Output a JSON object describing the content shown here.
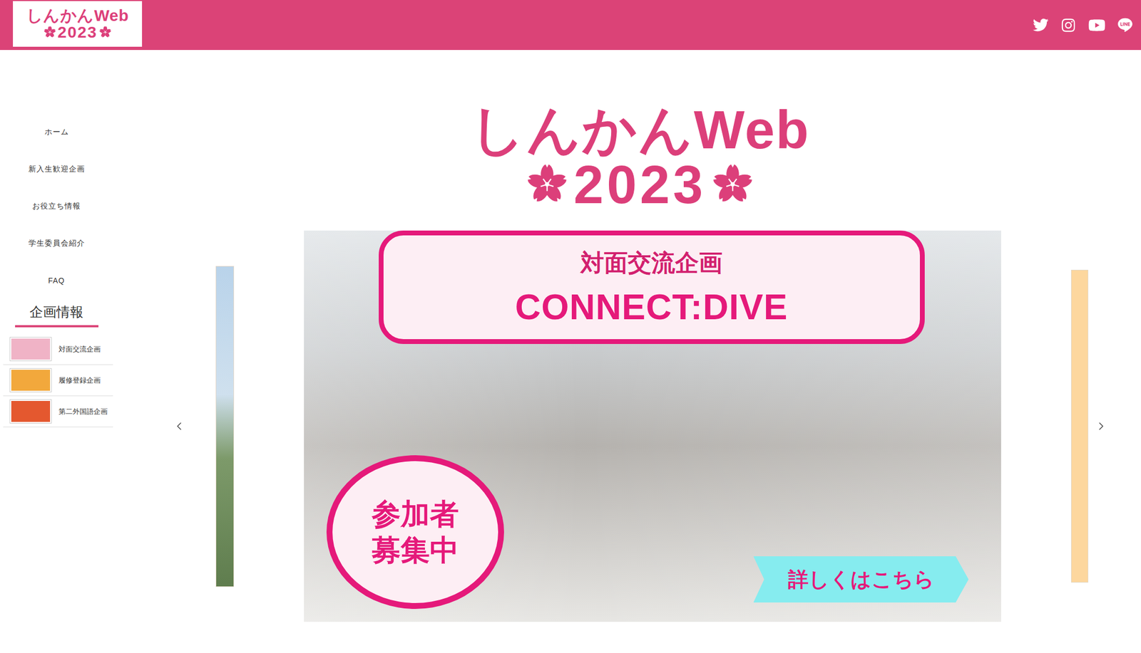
{
  "header": {
    "logo": {
      "title": "しんかんWeb",
      "year": "2023"
    }
  },
  "nav": [
    {
      "label": "ホーム"
    },
    {
      "label": "新入生歓迎企画"
    },
    {
      "label": "お役立ち情報"
    },
    {
      "label": "学生委員会紹介"
    },
    {
      "label": "FAQ"
    }
  ],
  "events": {
    "heading": "企画情報",
    "items": [
      {
        "label": "対面交流企画",
        "color": "#f0b3c6"
      },
      {
        "label": "履修登録企画",
        "color": "#f2a83c"
      },
      {
        "label": "第二外国語企画",
        "color": "#e4582f"
      }
    ]
  },
  "hero": {
    "logo": {
      "title": "しんかんWeb",
      "year": "2023"
    }
  },
  "slide": {
    "subtitle": "対面交流企画",
    "title": "CONNECT:DIVE",
    "badge_lines": [
      "参加者",
      "募集中"
    ],
    "cta": "詳しくはこちら"
  }
}
